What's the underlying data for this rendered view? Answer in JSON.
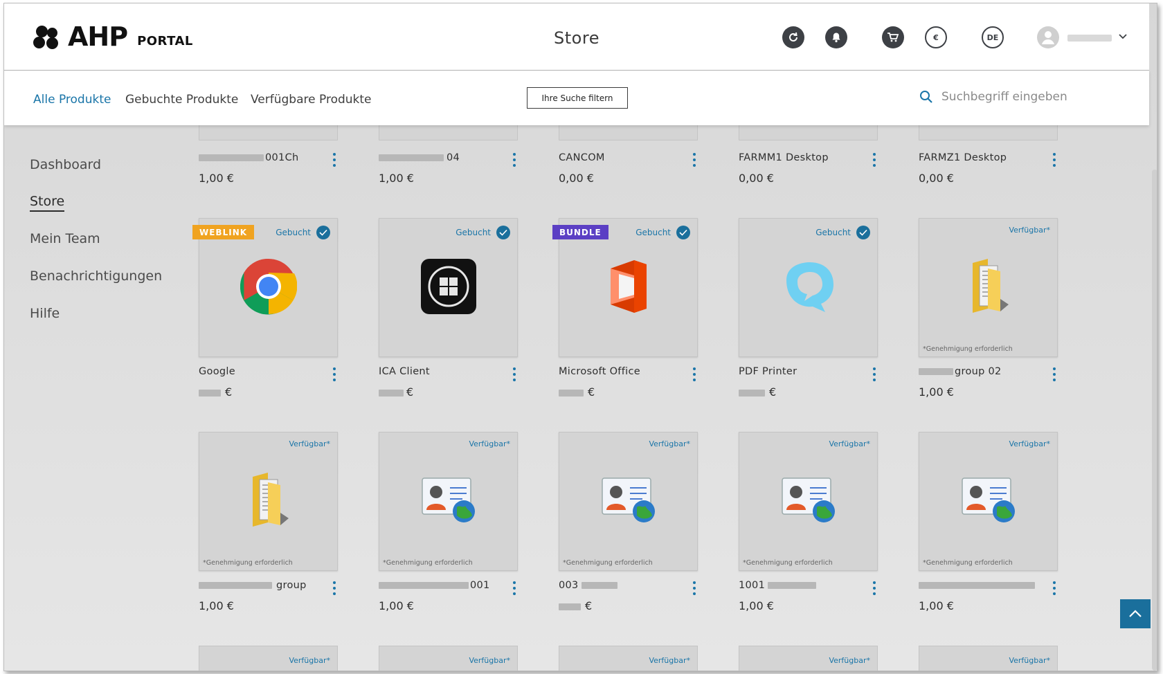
{
  "header": {
    "logo_text": "AHP",
    "logo_sub": "PORTAL",
    "title": "Store",
    "currency_label": "€",
    "language_label": "DE",
    "user_chevron": "v"
  },
  "subnav": {
    "tabs": [
      {
        "label": "Alle Produkte",
        "active": true
      },
      {
        "label": "Gebuchte Produkte",
        "active": false
      },
      {
        "label": "Verfügbare Produkte",
        "active": false
      }
    ],
    "filter_label": "Ihre Suche filtern",
    "search_placeholder": "Suchbegriff eingeben"
  },
  "sidebar": {
    "items": [
      {
        "label": "Dashboard"
      },
      {
        "label": "Store",
        "active": true
      },
      {
        "label": "Mein Team"
      },
      {
        "label": "Benachrichtigungen"
      },
      {
        "label": "Hilfe"
      }
    ]
  },
  "row0": [
    {
      "name": "001Ch",
      "price": "1,00 €"
    },
    {
      "name": "04",
      "price": "1,00 €"
    },
    {
      "name": "CANCOM",
      "price": "0,00 €"
    },
    {
      "name": "FARMM1 Desktop",
      "price": "0,00 €"
    },
    {
      "name": "FARMZ1 Desktop",
      "price": "0,00 €"
    }
  ],
  "row1": [
    {
      "name": "Google",
      "price": "€",
      "badge": "WEBLINK",
      "status": "Gebucht",
      "icon": "chrome-icon"
    },
    {
      "name": "ICA Client",
      "price": "€",
      "status": "Gebucht",
      "icon": "windows-icon"
    },
    {
      "name": "Microsoft Office",
      "price": "€",
      "badge": "BUNDLE",
      "status": "Gebucht",
      "icon": "office-icon"
    },
    {
      "name": "PDF Printer",
      "price": "€",
      "status": "Gebucht",
      "icon": "pdf-printer-icon"
    },
    {
      "name": "group 02",
      "price": "1,00 €",
      "status": "Verfügbar*",
      "note": "*Genehmigung erforderlich",
      "icon": "folder-icon"
    }
  ],
  "row2": [
    {
      "name": "group",
      "price": "1,00 €",
      "status": "Verfügbar*",
      "note": "*Genehmigung erforderlich",
      "icon": "folder-icon"
    },
    {
      "name": "001",
      "price": "1,00 €",
      "status": "Verfügbar*",
      "note": "*Genehmigung erforderlich",
      "icon": "contact-card-icon"
    },
    {
      "name": "003",
      "price": "€",
      "status": "Verfügbar*",
      "note": "*Genehmigung erforderlich",
      "icon": "contact-card-icon"
    },
    {
      "name": "1001",
      "price": "1,00 €",
      "status": "Verfügbar*",
      "note": "*Genehmigung erforderlich",
      "icon": "contact-card-icon"
    },
    {
      "name": "",
      "price": "1,00 €",
      "status": "Verfügbar*",
      "note": "*Genehmigung erforderlich",
      "icon": "contact-card-icon"
    }
  ],
  "row3": [
    {
      "status": "Verfügbar*"
    },
    {
      "status": "Verfügbar*"
    },
    {
      "status": "Verfügbar*"
    },
    {
      "status": "Verfügbar*"
    },
    {
      "status": "Verfügbar*"
    }
  ],
  "colors": {
    "accent": "#1a75a8",
    "weblink": "#f0a320",
    "bundle": "#5b3fc4"
  }
}
